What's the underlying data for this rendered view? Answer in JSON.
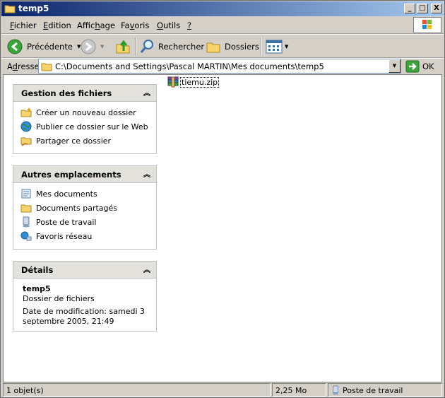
{
  "window": {
    "title": "temp5"
  },
  "window_buttons": {
    "minimize": "_",
    "maximize": "□",
    "close": "X"
  },
  "menu": {
    "items": [
      {
        "accel": "F",
        "rest": "ichier"
      },
      {
        "accel": "E",
        "rest": "dition"
      },
      {
        "pre": "Affic",
        "accel": "h",
        "rest": "age"
      },
      {
        "pre": "Fa",
        "accel": "v",
        "rest": "oris"
      },
      {
        "accel": "O",
        "rest": "utils"
      },
      {
        "accel": "?",
        "rest": ""
      }
    ]
  },
  "toolbar": {
    "back_label": "Précédente",
    "search_label": "Rechercher",
    "folders_label": "Dossiers"
  },
  "address": {
    "label_accel": "d",
    "label_pre": "A",
    "label_rest": "resse",
    "value": "C:\\Documents and Settings\\Pascal MARTIN\\Mes documents\\temp5",
    "go_label": "OK"
  },
  "panels": {
    "file_tasks": {
      "title": "Gestion des fichiers",
      "items": [
        {
          "label": "Créer un nouveau dossier",
          "icon": "new-folder-icon"
        },
        {
          "label": "Publier ce dossier sur le Web",
          "icon": "globe-icon"
        },
        {
          "label": "Partager ce dossier",
          "icon": "share-folder-icon"
        }
      ]
    },
    "other_places": {
      "title": "Autres emplacements",
      "items": [
        {
          "label": "Mes documents",
          "icon": "my-documents-icon"
        },
        {
          "label": "Documents partagés",
          "icon": "folder-icon"
        },
        {
          "label": "Poste de travail",
          "icon": "computer-icon"
        },
        {
          "label": "Favoris réseau",
          "icon": "network-icon"
        }
      ]
    },
    "details": {
      "title": "Détails",
      "name": "temp5",
      "type": "Dossier de fichiers",
      "modified_line1": "Date de modification: samedi 3",
      "modified_line2": "septembre 2005, 21:49"
    }
  },
  "files": [
    {
      "name": "tiemu.zip",
      "icon": "zip-archive-icon"
    }
  ],
  "status": {
    "count": "1 objet(s)",
    "size": "2,25 Mo",
    "location": "Poste de travail"
  },
  "colors": {
    "title_start": "#0a246a",
    "title_end": "#a6caf0",
    "chrome": "#d4d0c8",
    "panel_header": "#e3e1dc"
  }
}
